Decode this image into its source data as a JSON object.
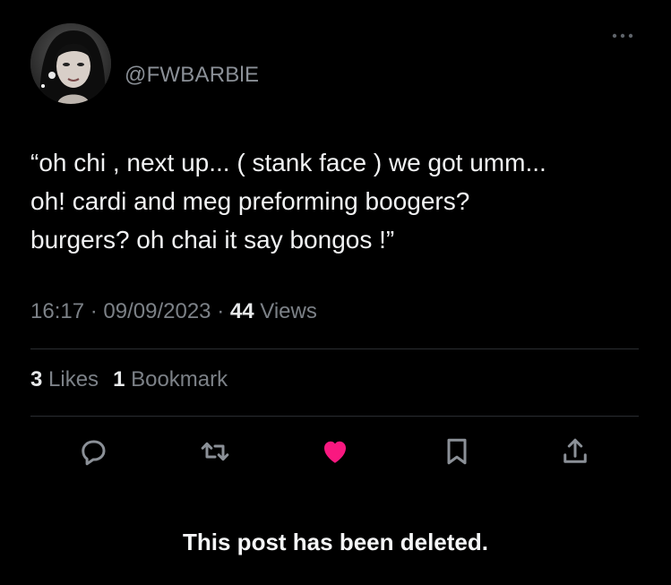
{
  "author": {
    "handle": "@FWBARBlE"
  },
  "tweet": {
    "lines": [
      "“oh chi , next up... ( stank face )  we got umm...",
      "oh! cardi and meg preforming boogers?",
      "burgers? oh chai it say bongos !”"
    ]
  },
  "meta": {
    "time": "16:17",
    "separator": "·",
    "date": "09/09/2023",
    "views_count": "44",
    "views_label": "Views"
  },
  "stats": {
    "likes_count": "3",
    "likes_label": "Likes",
    "bookmarks_count": "1",
    "bookmarks_label": "Bookmark"
  },
  "actions": [
    {
      "name": "reply",
      "icon": "reply-icon"
    },
    {
      "name": "retweet",
      "icon": "retweet-icon"
    },
    {
      "name": "like",
      "icon": "heart-icon",
      "liked": true
    },
    {
      "name": "bookmark",
      "icon": "bookmark-icon"
    },
    {
      "name": "share",
      "icon": "share-icon"
    }
  ],
  "colors": {
    "background": "#000000",
    "text": "#e7e9ea",
    "secondary": "#7c8187",
    "like": "#f91880",
    "icon": "#8b9097"
  },
  "notice": "This post has been deleted."
}
